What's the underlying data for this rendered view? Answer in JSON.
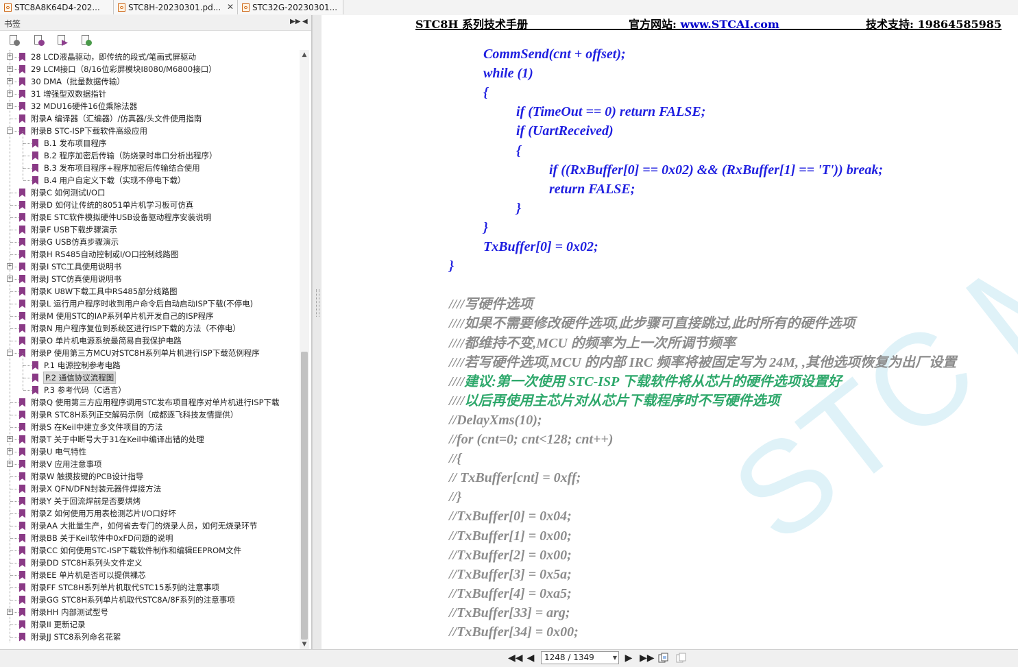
{
  "tabs": [
    {
      "title": "STC8A8K64D4-202..."
    },
    {
      "title": "STC8H-20230301.pd..."
    },
    {
      "title": "STC32G-20230301..."
    }
  ],
  "bookmark_panel": {
    "title": "书签",
    "items": [
      {
        "label": "28 LCD液晶驱动，即传统的段式/笔画式屏驱动",
        "level": 0,
        "expandable": true
      },
      {
        "label": "29 LCM接口（8/16位彩屏模块I8080/M6800接口）",
        "level": 0,
        "expandable": true
      },
      {
        "label": "30 DMA（批量数据传输）",
        "level": 0,
        "expandable": true
      },
      {
        "label": "31 增强型双数据指针",
        "level": 0,
        "expandable": true
      },
      {
        "label": "32 MDU16硬件16位乘除法器",
        "level": 0,
        "expandable": true
      },
      {
        "label": "附录A 编译器（汇编器）/仿真器/头文件使用指南",
        "level": 0,
        "expandable": false
      },
      {
        "label": "附录B STC-ISP下载软件高级应用",
        "level": 0,
        "expandable": true,
        "expanded": true
      },
      {
        "label": "B.1 发布项目程序",
        "level": 1
      },
      {
        "label": "B.2 程序加密后传输（防烧录时串口分析出程序）",
        "level": 1
      },
      {
        "label": "B.3 发布项目程序+程序加密后传输结合使用",
        "level": 1
      },
      {
        "label": "B.4 用户自定义下载（实现不停电下载）",
        "level": 1
      },
      {
        "label": "附录C 如何测试I/O口",
        "level": 0
      },
      {
        "label": "附录D 如何让传统的8051单片机学习板可仿真",
        "level": 0
      },
      {
        "label": "附录E STC软件模拟硬件USB设备驱动程序安装说明",
        "level": 0
      },
      {
        "label": "附录F USB下载步骤演示",
        "level": 0
      },
      {
        "label": "附录G USB仿真步骤演示",
        "level": 0
      },
      {
        "label": "附录H RS485自动控制或I/O口控制线路图",
        "level": 0
      },
      {
        "label": "附录I STC工具使用说明书",
        "level": 0,
        "expandable": true
      },
      {
        "label": "附录J STC仿真使用说明书",
        "level": 0,
        "expandable": true
      },
      {
        "label": "附录K U8W下载工具中RS485部分线路图",
        "level": 0
      },
      {
        "label": "附录L 运行用户程序时收到用户命令后自动启动ISP下载(不停电)",
        "level": 0
      },
      {
        "label": "附录M 使用STC的IAP系列单片机开发自己的ISP程序",
        "level": 0
      },
      {
        "label": "附录N 用户程序复位到系统区进行ISP下载的方法（不停电）",
        "level": 0
      },
      {
        "label": "附录O 单片机电源系统最简易自我保护电路",
        "level": 0
      },
      {
        "label": "附录P 使用第三方MCU对STC8H系列单片机进行ISP下载范例程序",
        "level": 0,
        "expandable": true,
        "expanded": true
      },
      {
        "label": "P.1 电源控制参考电路",
        "level": 1
      },
      {
        "label": "P.2 通信协议流程图",
        "level": 1,
        "selected": true
      },
      {
        "label": "P.3 参考代码（C语言）",
        "level": 1
      },
      {
        "label": "附录Q 使用第三方应用程序调用STC发布项目程序对单片机进行ISP下载",
        "level": 0
      },
      {
        "label": "附录R STC8H系列正交解码示例（成都逐飞科技友情提供）",
        "level": 0
      },
      {
        "label": "附录S 在Keil中建立多文件项目的方法",
        "level": 0
      },
      {
        "label": "附录T 关于中断号大于31在Keil中编译出错的处理",
        "level": 0,
        "expandable": true
      },
      {
        "label": "附录U 电气特性",
        "level": 0,
        "expandable": true
      },
      {
        "label": "附录V 应用注意事项",
        "level": 0,
        "expandable": true
      },
      {
        "label": "附录W 触摸按键的PCB设计指导",
        "level": 0
      },
      {
        "label": "附录X QFN/DFN封装元器件焊接方法",
        "level": 0
      },
      {
        "label": "附录Y 关于回流焊前是否要烘烤",
        "level": 0
      },
      {
        "label": "附录Z 如何使用万用表检测芯片I/O口好坏",
        "level": 0
      },
      {
        "label": "附录AA 大批量生产，如何省去专门的烧录人员，如何无烧录环节",
        "level": 0
      },
      {
        "label": "附录BB 关于Keil软件中0xFD问题的说明",
        "level": 0
      },
      {
        "label": "附录CC 如何使用STC-ISP下载软件制作和编辑EEPROM文件",
        "level": 0
      },
      {
        "label": "附录DD STC8H系列头文件定义",
        "level": 0
      },
      {
        "label": "附录EE 单片机是否可以提供裸芯",
        "level": 0
      },
      {
        "label": "附录FF STC8H系列单片机取代STC15系列的注意事项",
        "level": 0
      },
      {
        "label": "附录GG STC8H系列单片机取代STC8A/8F系列的注意事项",
        "level": 0
      },
      {
        "label": "附录HH 内部测试型号",
        "level": 0,
        "expandable": true
      },
      {
        "label": "附录II 更新记录",
        "level": 0
      },
      {
        "label": "附录JJ STC8系列命名花絮",
        "level": 0
      }
    ]
  },
  "document": {
    "header_left": "STC8H 系列技术手册",
    "header_mid_label": "官方网站:",
    "header_mid_link": "www.STCAI.com",
    "header_right": "技术支持: 19864585985",
    "watermark": "STC MCU",
    "lines": [
      {
        "text": "CommSend(cnt + offset);",
        "indent": 1,
        "color": "blue"
      },
      {
        "text": "while (1)",
        "indent": 1,
        "color": "blue"
      },
      {
        "text": "{",
        "indent": 1,
        "color": "blue"
      },
      {
        "text": "if (TimeOut == 0) return FALSE;",
        "indent": 2,
        "color": "blue"
      },
      {
        "text": "if (UartReceived)",
        "indent": 2,
        "color": "blue"
      },
      {
        "text": "{",
        "indent": 2,
        "color": "blue"
      },
      {
        "text": "if ((RxBuffer[0] == 0x02) && (RxBuffer[1] == 'T')) break;",
        "indent": 3,
        "color": "blue"
      },
      {
        "text": "return FALSE;",
        "indent": 3,
        "color": "blue"
      },
      {
        "text": "}",
        "indent": 2,
        "color": "blue"
      },
      {
        "text": "}",
        "indent": 1,
        "color": "blue"
      },
      {
        "text": "TxBuffer[0] = 0x02;",
        "indent": 1,
        "color": "blue"
      },
      {
        "text": "}",
        "indent": 0,
        "color": "blue"
      },
      {
        "text": "",
        "indent": 0,
        "color": "blue"
      },
      {
        "text": "////写硬件选项",
        "indent": 0,
        "color": "gray"
      },
      {
        "text": "////如果不需要修改硬件选项,此步骤可直接跳过,此时所有的硬件选项",
        "indent": 0,
        "color": "gray"
      },
      {
        "text": "////都维持不变,MCU 的频率为上一次所调节频率",
        "indent": 0,
        "color": "gray"
      },
      {
        "text": "////若写硬件选项,MCU 的内部 IRC 频率将被固定写为 24M, ,其他选项恢复为出厂设置",
        "indent": 0,
        "color": "gray"
      },
      {
        "text": "////建议:第一次使用 STC-ISP 下载软件将从芯片的硬件选项设置好",
        "indent": 0,
        "color": "mixed",
        "prefix": "////",
        "rest": "建议:第一次使用 STC-ISP 下载软件将从芯片的硬件选项设置好"
      },
      {
        "text": "////以后再使用主芯片对从芯片下载程序时不写硬件选项",
        "indent": 0,
        "color": "mixed",
        "prefix": "////",
        "rest": "以后再使用主芯片对从芯片下载程序时不写硬件选项"
      },
      {
        "text": "//DelayXms(10);",
        "indent": 0,
        "color": "gray"
      },
      {
        "text": "//for (cnt=0; cnt<128; cnt++)",
        "indent": 0,
        "color": "gray"
      },
      {
        "text": "//{",
        "indent": 0,
        "color": "gray"
      },
      {
        "text": "//        TxBuffer[cnt] = 0xff;",
        "indent": 0,
        "color": "gray"
      },
      {
        "text": "//}",
        "indent": 0,
        "color": "gray"
      },
      {
        "text": "//TxBuffer[0] = 0x04;",
        "indent": 0,
        "color": "gray"
      },
      {
        "text": "//TxBuffer[1] = 0x00;",
        "indent": 0,
        "color": "gray"
      },
      {
        "text": "//TxBuffer[2] = 0x00;",
        "indent": 0,
        "color": "gray"
      },
      {
        "text": "//TxBuffer[3] = 0x5a;",
        "indent": 0,
        "color": "gray"
      },
      {
        "text": "//TxBuffer[4] = 0xa5;",
        "indent": 0,
        "color": "gray"
      },
      {
        "text": "//TxBuffer[33] = arg;",
        "indent": 0,
        "color": "gray"
      },
      {
        "text": "//TxBuffer[34] = 0x00;",
        "indent": 0,
        "color": "gray"
      }
    ]
  },
  "navigation": {
    "page_indicator": "1248 / 1349"
  },
  "colors": {
    "code_blue": "#1f1fe0",
    "comment_gray": "#8c8c8c",
    "comment_green": "#2ea86b",
    "bookmark_purple": "#8a3a86",
    "pdf_orange": "#d06a1b"
  }
}
